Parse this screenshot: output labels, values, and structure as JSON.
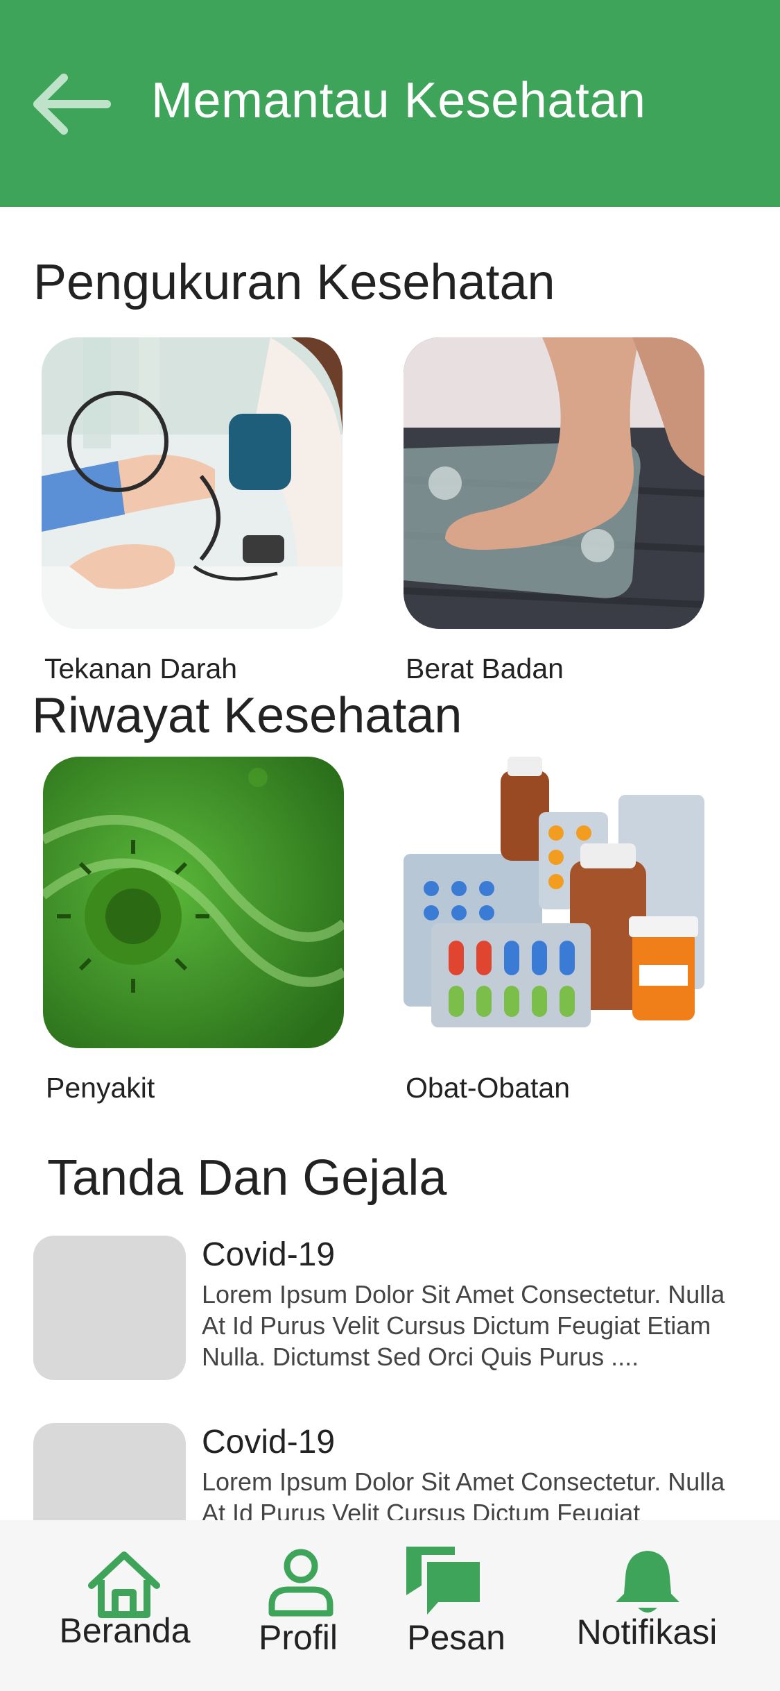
{
  "header": {
    "title": "Memantau Kesehatan",
    "back_icon": "arrow-left-icon"
  },
  "measurements": {
    "title": "Pengukuran Kesehatan",
    "items": [
      {
        "label": "Tekanan Darah",
        "image": "blood-pressure-photo"
      },
      {
        "label": "Berat Badan",
        "image": "weight-scale-photo"
      }
    ]
  },
  "history": {
    "title": "Riwayat Kesehatan",
    "items": [
      {
        "label": "Penyakit",
        "image": "virus-photo"
      },
      {
        "label": "Obat-Obatan",
        "image": "medicine-photo"
      }
    ]
  },
  "symptoms": {
    "title": "Tanda Dan Gejala",
    "items": [
      {
        "title": "Covid-19",
        "desc": "Lorem Ipsum Dolor Sit Amet Consectetur. Nulla At Id Purus Velit Cursus Dictum Feugiat Etiam Nulla. Dictumst Sed Orci Quis Purus ...."
      },
      {
        "title": "Covid-19",
        "desc": "Lorem Ipsum Dolor Sit Amet Consectetur. Nulla At Id Purus Velit Cursus Dictum Feugiat"
      }
    ]
  },
  "nav": {
    "items": [
      {
        "label": "Beranda",
        "icon": "home-icon"
      },
      {
        "label": "Profil",
        "icon": "user-icon"
      },
      {
        "label": "Pesan",
        "icon": "chat-icon"
      },
      {
        "label": "Notifikasi",
        "icon": "bell-icon"
      }
    ]
  },
  "colors": {
    "primary": "#3ea45a",
    "nav_background": "#f6f6f6",
    "placeholder": "#d9d9d9"
  }
}
